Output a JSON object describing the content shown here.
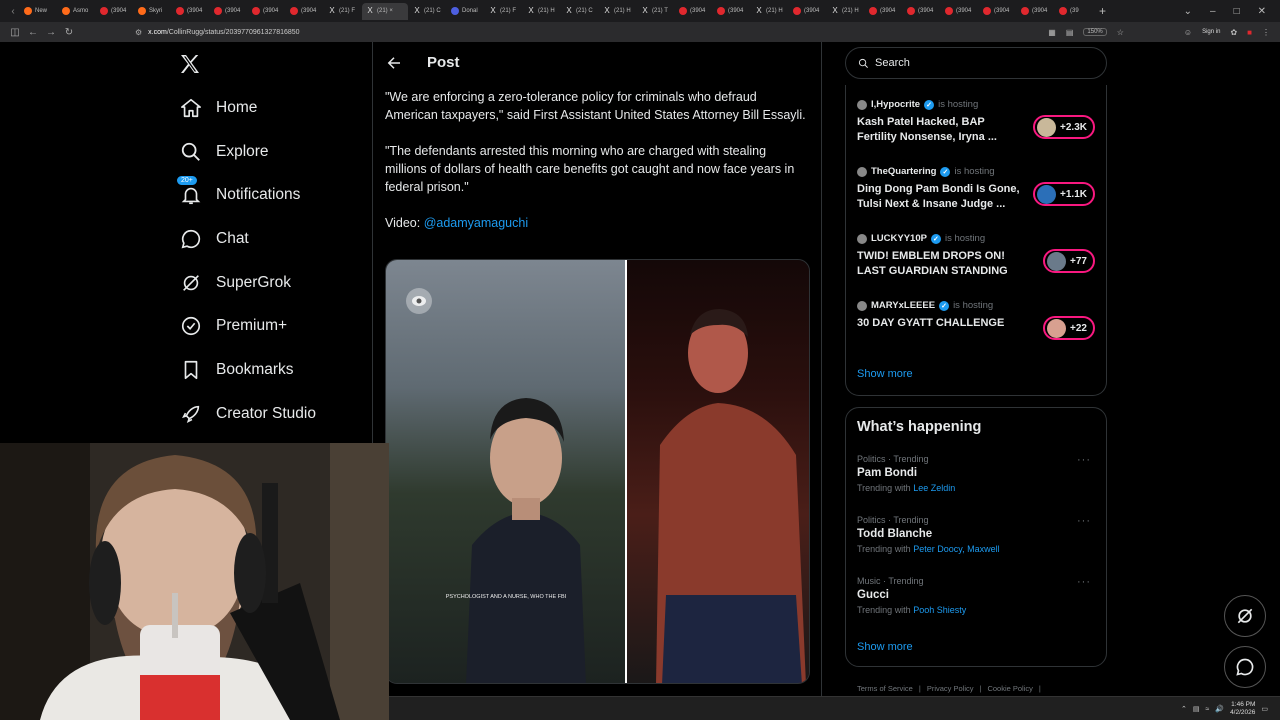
{
  "browser": {
    "tabs": [
      {
        "label": "",
        "icon": "chevron-left-icon"
      },
      {
        "label": "New",
        "icon": "firefox-icon"
      },
      {
        "label": "Asmo",
        "icon": "firefox-icon"
      },
      {
        "label": "(3904",
        "icon": "youtube-icon"
      },
      {
        "label": "Skyri",
        "icon": "firefox-icon"
      },
      {
        "label": "(3904",
        "icon": "youtube-icon"
      },
      {
        "label": "(3904",
        "icon": "youtube-icon"
      },
      {
        "label": "(3904",
        "icon": "youtube-icon"
      },
      {
        "label": "(3904",
        "icon": "youtube-icon"
      },
      {
        "label": "(21) F",
        "icon": "x-icon"
      },
      {
        "label": "(21) ×",
        "icon": "x-icon",
        "active": true
      },
      {
        "label": "(21) C",
        "icon": "x-icon"
      },
      {
        "label": "Donal",
        "icon": "blue-icon"
      },
      {
        "label": "(21) F",
        "icon": "x-icon"
      },
      {
        "label": "(21) H",
        "icon": "x-icon"
      },
      {
        "label": "(21) C",
        "icon": "x-icon"
      },
      {
        "label": "(21) H",
        "icon": "x-icon"
      },
      {
        "label": "(21) T",
        "icon": "x-icon"
      },
      {
        "label": "(3904",
        "icon": "youtube-icon"
      },
      {
        "label": "(3904",
        "icon": "youtube-icon"
      },
      {
        "label": "(21) H",
        "icon": "x-icon"
      },
      {
        "label": "(3904",
        "icon": "youtube-icon"
      },
      {
        "label": "(21) H",
        "icon": "x-icon"
      },
      {
        "label": "(3904",
        "icon": "youtube-icon"
      },
      {
        "label": "(3904",
        "icon": "youtube-icon"
      },
      {
        "label": "(3904",
        "icon": "youtube-icon"
      },
      {
        "label": "(3904",
        "icon": "youtube-icon"
      },
      {
        "label": "(3904",
        "icon": "youtube-icon"
      },
      {
        "label": "(39",
        "icon": "youtube-icon"
      }
    ],
    "url_domain": "x.com",
    "url_path": "/CollinRugg/status/2039770961327816850",
    "zoom": "150%",
    "signin": "Sign in"
  },
  "nav": {
    "items": [
      {
        "label": "Home",
        "icon": "home-icon"
      },
      {
        "label": "Explore",
        "icon": "search-icon"
      },
      {
        "label": "Notifications",
        "icon": "bell-icon",
        "badge": "20+"
      },
      {
        "label": "Chat",
        "icon": "chat-icon"
      },
      {
        "label": "SuperGrok",
        "icon": "grok-icon"
      },
      {
        "label": "Premium+",
        "icon": "verified-icon"
      },
      {
        "label": "Bookmarks",
        "icon": "bookmark-icon"
      },
      {
        "label": "Creator Studio",
        "icon": "rocket-icon"
      }
    ]
  },
  "post": {
    "header_title": "Post",
    "paragraph1": "\"We are enforcing a zero-tolerance policy for criminals who defraud American taxpayers,\" said First Assistant United States Attorney Bill Essayli.",
    "paragraph2": "\"The defendants arrested this morning who are charged with stealing millions of dollars of health care benefits got caught and now face years in federal prison.\"",
    "video_label": "Video: ",
    "video_mention": "@adamyamaguchi",
    "caption": "PSYCHOLOGIST AND A NURSE, WHO THE FBI"
  },
  "search": {
    "placeholder": "Search"
  },
  "spaces": [
    {
      "host": "I,Hypocrite",
      "status": "is hosting",
      "title": "Kash Patel Hacked, BAP Fertility Nonsense, Iryna ...",
      "listeners": "+2.3K"
    },
    {
      "host": "TheQuartering",
      "status": "is hosting",
      "title": "Ding Dong Pam Bondi Is Gone, Tulsi Next & Insane Judge ...",
      "listeners": "+1.1K"
    },
    {
      "host": "LUCKYY10P",
      "status": "is hosting",
      "title": "TWID! EMBLEM DROPS ON! LAST GUARDIAN STANDING",
      "listeners": "+77"
    },
    {
      "host": "MARYxLEEEE",
      "status": "is hosting",
      "title": "30 DAY GYATT CHALLENGE",
      "listeners": "+22"
    }
  ],
  "spaces_show_more": "Show more",
  "happening": {
    "title": "What’s happening",
    "trends": [
      {
        "meta": "Politics · Trending",
        "name": "Pam Bondi",
        "with_label": "Trending with",
        "with": "Lee Zeldin"
      },
      {
        "meta": "Politics · Trending",
        "name": "Todd Blanche",
        "with_label": "Trending with",
        "with": "Peter Doocy, Maxwell"
      },
      {
        "meta": "Music · Trending",
        "name": "Gucci",
        "with_label": "Trending with",
        "with": "Pooh Shiesty"
      }
    ],
    "show_more": "Show more"
  },
  "footer": {
    "links": [
      "Terms of Service",
      "|",
      "Privacy Policy",
      "|",
      "Cookie Policy",
      "|"
    ]
  },
  "taskbar": {
    "time": "1:46 PM",
    "date": "4/2/2026"
  }
}
